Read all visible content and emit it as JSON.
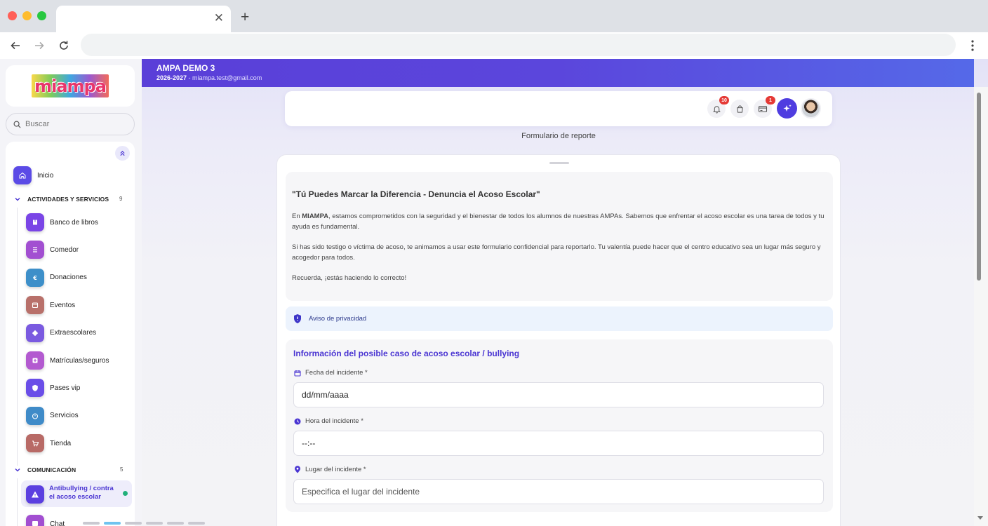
{
  "browser": {
    "tab_close": "✕",
    "new_tab": "+"
  },
  "logo": {
    "text": "miampa"
  },
  "search": {
    "placeholder": "Buscar"
  },
  "sidebar": {
    "inicio": "Inicio",
    "sections": [
      {
        "title": "ACTIVIDADES Y SERVICIOS",
        "count": "9"
      },
      {
        "title": "COMUNICACIÓN",
        "count": "5"
      }
    ],
    "items": [
      {
        "label": "Banco de libros",
        "color": "#7a45e6",
        "icon": "book-icon"
      },
      {
        "label": "Comedor",
        "color": "#a24fd1",
        "icon": "list-icon"
      },
      {
        "label": "Donaciones",
        "color": "#3d8fc9",
        "icon": "euro-icon"
      },
      {
        "label": "Eventos",
        "color": "#b8706a",
        "icon": "calendar-icon"
      },
      {
        "label": "Extraescolares",
        "color": "#7a5ae0",
        "icon": "diamond-icon"
      },
      {
        "label": "Matrículas/seguros",
        "color": "#b35ad0",
        "icon": "plus-box-icon"
      },
      {
        "label": "Pases vip",
        "color": "#6a4ee8",
        "icon": "shield-icon"
      },
      {
        "label": "Servicios",
        "color": "#3f8bc8",
        "icon": "timer-icon"
      },
      {
        "label": "Tienda",
        "color": "#b86a66",
        "icon": "cart-icon"
      }
    ],
    "communication_items": [
      {
        "label": "Antibullying / contra el acoso escolar",
        "active": true,
        "color": "#5b3fe0"
      },
      {
        "label": "Chat",
        "color": "#a24fd1"
      }
    ]
  },
  "header": {
    "title": "AMPA DEMO 3",
    "year": "2026-2027",
    "separator": " - ",
    "email": "miampa.test@gmail.com"
  },
  "toolbar": {
    "notifications_count": "10",
    "cart_badge": "1",
    "notifications_icon": "bell-icon",
    "bag_icon": "bag-icon",
    "card_icon": "credit-card-icon",
    "ai_icon": "sparkle-icon"
  },
  "page": {
    "caption": "Formulario de reporte"
  },
  "intro": {
    "heading": "\"Tú Puedes Marcar la Diferencia - Denuncia el Acoso Escolar\"",
    "p1_prefix": "En ",
    "p1_brand": "MIAMPA",
    "p1_rest": ", estamos comprometidos con la seguridad y el bienestar de todos los alumnos de nuestras AMPAs. Sabemos que enfrentar el acoso escolar es una tarea de todos y tu ayuda es fundamental.",
    "p2": "Si has sido testigo o víctima de acoso, te animamos a usar este formulario confidencial para reportarlo. Tu valentía puede hacer que el centro educativo sea un lugar más seguro y acogedor para todos.",
    "p3": "Recuerda, ¡estás haciendo lo correcto!"
  },
  "privacy": {
    "label": "Aviso de privacidad"
  },
  "form": {
    "section_title": "Información del posible caso de acoso escolar / bullying",
    "date_label": "Fecha del incidente *",
    "date_value": "dd/mm/aaaa",
    "time_label": "Hora del incidente *",
    "time_value": "--:--",
    "place_label": "Lugar del incidente *",
    "place_placeholder": "Especifica el lugar del incidente"
  },
  "colors": {
    "accent": "#4a35d2",
    "banner_start": "#5a3fd8",
    "banner_end": "#5569e8",
    "badge": "#e53935",
    "online": "#21b07a"
  }
}
